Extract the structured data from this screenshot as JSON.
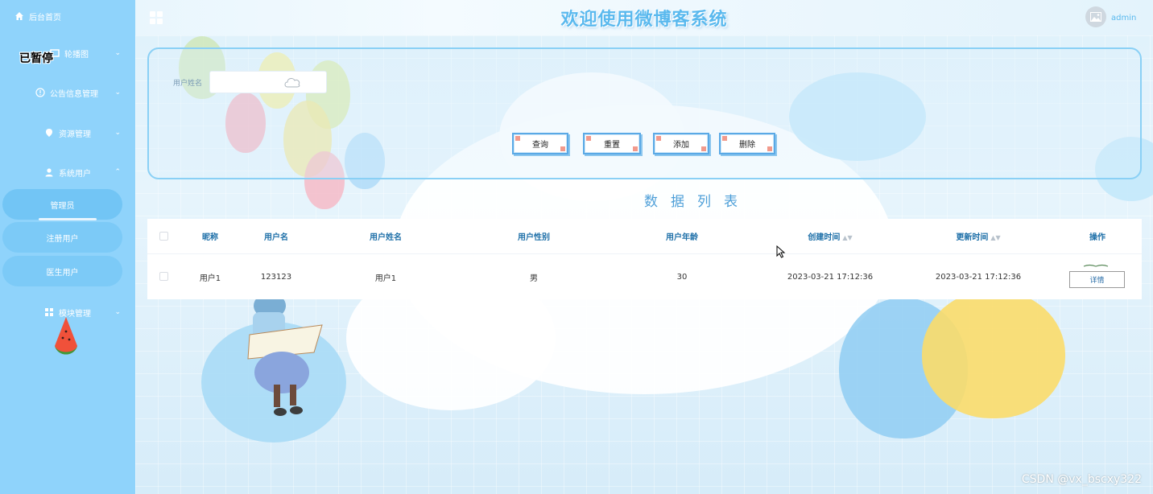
{
  "sidebar": {
    "home": "后台首页",
    "carousel": "轮播图",
    "notice": "公告信息管理",
    "resource": "资源管理",
    "system_users": "系统用户",
    "sub_items": [
      "管理员",
      "注册用户",
      "医生用户"
    ],
    "module": "模块管理",
    "paused_overlay": "已暂停"
  },
  "header": {
    "title": "欢迎使用微博客系统",
    "username": "admin"
  },
  "search": {
    "label": "用户姓名",
    "value": "",
    "buttons": {
      "query": "查询",
      "reset": "重置",
      "add": "添加",
      "delete": "删除"
    }
  },
  "list_title": "数据列表",
  "table": {
    "columns": [
      "昵称",
      "用户名",
      "用户姓名",
      "用户性别",
      "用户年龄",
      "创建时间",
      "更新时间",
      "操作"
    ],
    "rows": [
      {
        "nickname": "用户1",
        "username": "123123",
        "name": "用户1",
        "gender": "男",
        "age": "30",
        "created": "2023-03-21 17:12:36",
        "updated": "2023-03-21 17:12:36",
        "action": "详情"
      }
    ]
  },
  "watermark": "CSDN @vx_bscxy322",
  "colors": {
    "sidebar": "#8fd3fb",
    "accent": "#5ab9ee",
    "header_text": "#1d6fa8"
  }
}
